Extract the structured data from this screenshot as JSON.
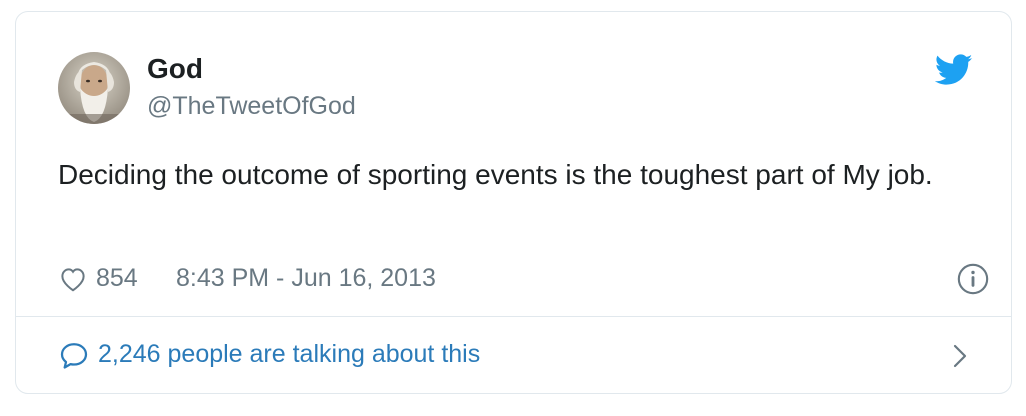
{
  "tweet": {
    "author": {
      "name": "God",
      "handle": "@TheTweetOfGod",
      "avatar_icon": "bearded-man-avatar"
    },
    "text": "Deciding the outcome of sporting events is the toughest part of My job.",
    "likes": "854",
    "timestamp": "8:43 PM - Jun 16, 2013",
    "conversation": "2,246 people are talking about this"
  },
  "icons": {
    "brand": "twitter-bird-icon",
    "like": "heart-icon",
    "info": "info-icon",
    "reply": "speech-bubble-icon",
    "expand": "chevron-right-icon"
  },
  "colors": {
    "twitter_blue": "#1da1f2",
    "link_blue": "#2b7bb9",
    "text": "#1c2022",
    "muted": "#697882",
    "border": "#e1e8ed"
  }
}
